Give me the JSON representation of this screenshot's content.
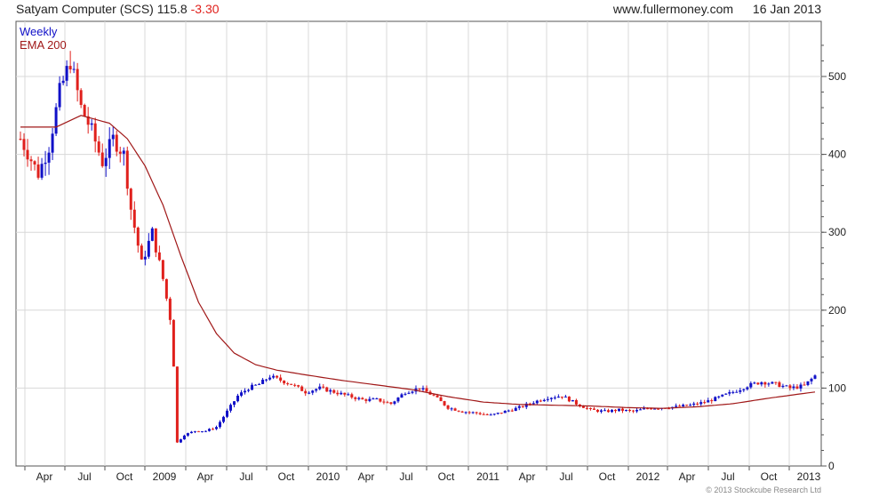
{
  "header": {
    "title": "Satyam Computer (SCS) 115.8",
    "change": "-3.30",
    "website": "www.fullermoney.com",
    "date": "16 Jan 2013"
  },
  "copyright": "© 2013 Stockcube Research Ltd",
  "colors": {
    "up": "#1010c8",
    "down": "#e0201c",
    "ema": "#a01818",
    "grid": "#d8d8d8"
  },
  "chart_data": {
    "type": "candlestick",
    "title": "Satyam Computer (SCS) 115.8 -3.30",
    "legend": [
      {
        "label": "Weekly",
        "color": "#1010c8"
      },
      {
        "label": "EMA 200",
        "color": "#a01818"
      }
    ],
    "legend_position": "top-left",
    "grid": true,
    "y_axis_side": "right",
    "ylim": [
      0,
      550
    ],
    "y_ticks": [
      0,
      100,
      200,
      300,
      400,
      500
    ],
    "x_ticks": [
      "Apr",
      "Jul",
      "Oct",
      "2009",
      "Apr",
      "Jul",
      "Oct",
      "2010",
      "Apr",
      "Jul",
      "Oct",
      "2011",
      "Apr",
      "Jul",
      "Oct",
      "2012",
      "Apr",
      "Jul",
      "Oct",
      "2013"
    ],
    "weekly_close_approx": [
      {
        "t": 0,
        "v": 420
      },
      {
        "t": 5,
        "v": 375
      },
      {
        "t": 8,
        "v": 410
      },
      {
        "t": 11,
        "v": 480
      },
      {
        "t": 14,
        "v": 520
      },
      {
        "t": 17,
        "v": 460
      },
      {
        "t": 20,
        "v": 430
      },
      {
        "t": 23,
        "v": 390
      },
      {
        "t": 26,
        "v": 420
      },
      {
        "t": 29,
        "v": 400
      },
      {
        "t": 31,
        "v": 330
      },
      {
        "t": 34,
        "v": 260
      },
      {
        "t": 37,
        "v": 300
      },
      {
        "t": 40,
        "v": 240
      },
      {
        "t": 42,
        "v": 190
      },
      {
        "t": 43,
        "v": 130
      },
      {
        "t": 44,
        "v": 30
      },
      {
        "t": 46,
        "v": 40
      },
      {
        "t": 49,
        "v": 45
      },
      {
        "t": 52,
        "v": 45
      },
      {
        "t": 55,
        "v": 50
      },
      {
        "t": 58,
        "v": 70
      },
      {
        "t": 61,
        "v": 90
      },
      {
        "t": 64,
        "v": 100
      },
      {
        "t": 67,
        "v": 105
      },
      {
        "t": 70,
        "v": 115
      },
      {
        "t": 73,
        "v": 110
      },
      {
        "t": 76,
        "v": 105
      },
      {
        "t": 80,
        "v": 95
      },
      {
        "t": 84,
        "v": 100
      },
      {
        "t": 88,
        "v": 95
      },
      {
        "t": 92,
        "v": 90
      },
      {
        "t": 96,
        "v": 85
      },
      {
        "t": 100,
        "v": 85
      },
      {
        "t": 104,
        "v": 80
      },
      {
        "t": 108,
        "v": 95
      },
      {
        "t": 112,
        "v": 100
      },
      {
        "t": 116,
        "v": 90
      },
      {
        "t": 120,
        "v": 75
      },
      {
        "t": 124,
        "v": 70
      },
      {
        "t": 128,
        "v": 68
      },
      {
        "t": 132,
        "v": 65
      },
      {
        "t": 136,
        "v": 70
      },
      {
        "t": 140,
        "v": 75
      },
      {
        "t": 144,
        "v": 82
      },
      {
        "t": 148,
        "v": 88
      },
      {
        "t": 152,
        "v": 90
      },
      {
        "t": 156,
        "v": 80
      },
      {
        "t": 160,
        "v": 72
      },
      {
        "t": 164,
        "v": 70
      },
      {
        "t": 168,
        "v": 72
      },
      {
        "t": 172,
        "v": 70
      },
      {
        "t": 176,
        "v": 74
      },
      {
        "t": 180,
        "v": 75
      },
      {
        "t": 184,
        "v": 76
      },
      {
        "t": 188,
        "v": 78
      },
      {
        "t": 192,
        "v": 82
      },
      {
        "t": 196,
        "v": 88
      },
      {
        "t": 200,
        "v": 95
      },
      {
        "t": 204,
        "v": 103
      },
      {
        "t": 208,
        "v": 108
      },
      {
        "t": 212,
        "v": 105
      },
      {
        "t": 216,
        "v": 100
      },
      {
        "t": 220,
        "v": 103
      },
      {
        "t": 223,
        "v": 115.8
      }
    ],
    "ema_200_approx": [
      {
        "t": 0,
        "v": 435
      },
      {
        "t": 10,
        "v": 435
      },
      {
        "t": 17,
        "v": 450
      },
      {
        "t": 25,
        "v": 440
      },
      {
        "t": 30,
        "v": 420
      },
      {
        "t": 35,
        "v": 385
      },
      {
        "t": 40,
        "v": 335
      },
      {
        "t": 45,
        "v": 270
      },
      {
        "t": 50,
        "v": 210
      },
      {
        "t": 55,
        "v": 170
      },
      {
        "t": 60,
        "v": 145
      },
      {
        "t": 66,
        "v": 130
      },
      {
        "t": 72,
        "v": 123
      },
      {
        "t": 80,
        "v": 117
      },
      {
        "t": 90,
        "v": 110
      },
      {
        "t": 100,
        "v": 104
      },
      {
        "t": 110,
        "v": 98
      },
      {
        "t": 120,
        "v": 89
      },
      {
        "t": 130,
        "v": 82
      },
      {
        "t": 140,
        "v": 79
      },
      {
        "t": 150,
        "v": 78
      },
      {
        "t": 160,
        "v": 77
      },
      {
        "t": 170,
        "v": 75
      },
      {
        "t": 180,
        "v": 74
      },
      {
        "t": 190,
        "v": 76
      },
      {
        "t": 200,
        "v": 80
      },
      {
        "t": 210,
        "v": 87
      },
      {
        "t": 218,
        "v": 92
      },
      {
        "t": 223,
        "v": 95
      }
    ]
  }
}
